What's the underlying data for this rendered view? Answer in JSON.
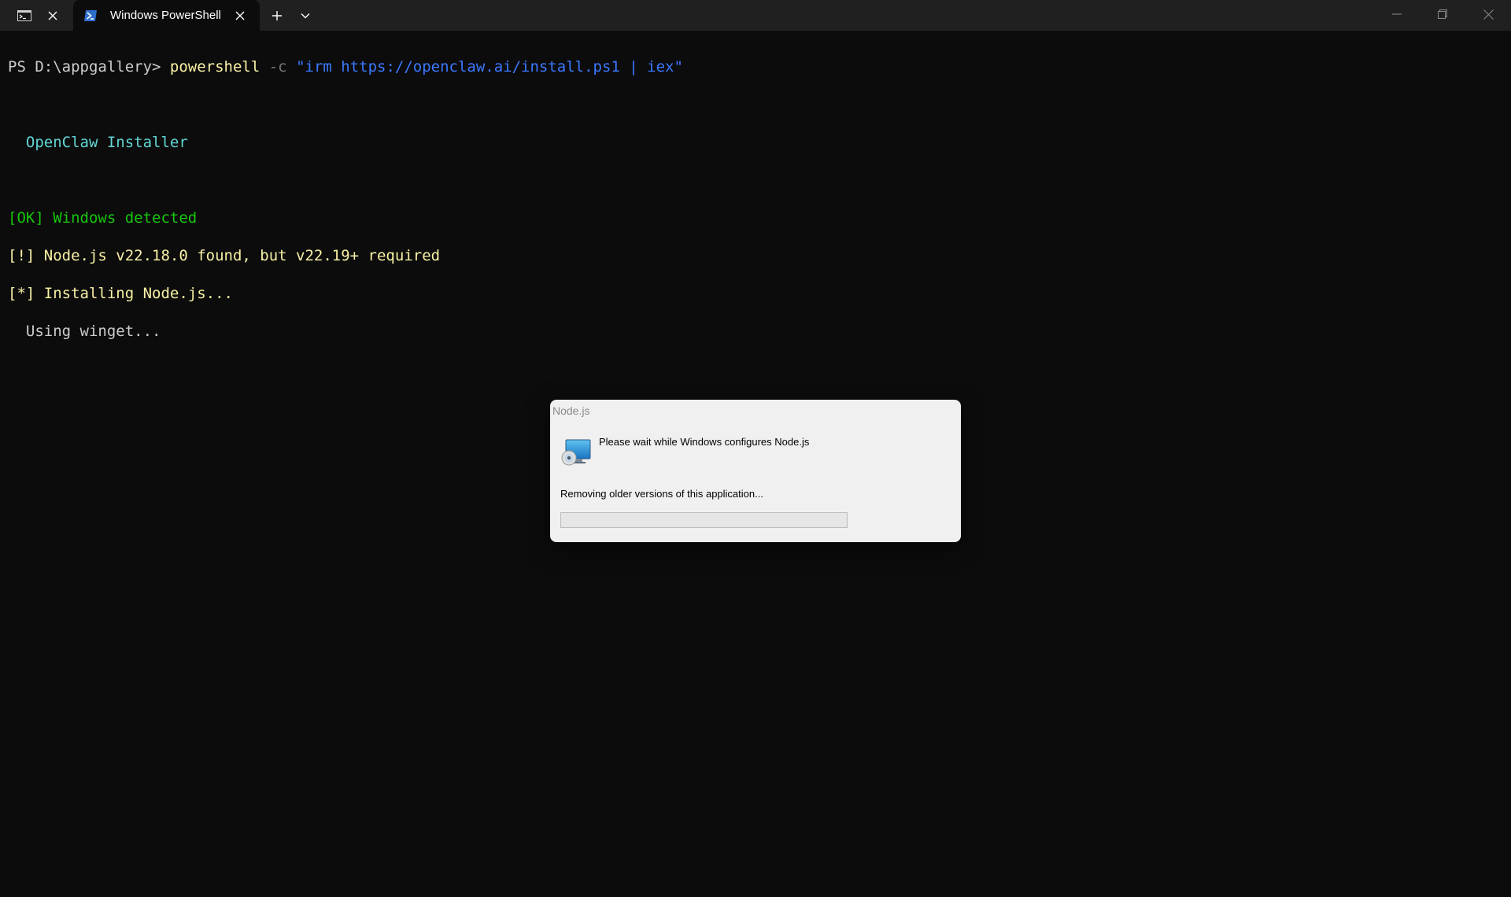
{
  "tabs": [
    {
      "title": "",
      "icon": "command-prompt-icon",
      "active": false
    },
    {
      "title": "Windows PowerShell",
      "icon": "powershell-icon",
      "active": true
    }
  ],
  "terminal": {
    "prompt": "PS D:\\appgallery> ",
    "command_name": "powershell",
    "command_flag": " -c ",
    "command_arg": "\"irm https://openclaw.ai/install.ps1 | iex\"",
    "installer_title": "  OpenClaw Installer",
    "line_ok": "[OK] Windows detected",
    "line_warn": "[!] Node.js v22.18.0 found, but v22.19+ required",
    "line_installing": "[*] Installing Node.js...",
    "line_winget": "  Using winget..."
  },
  "dialog": {
    "title": "Node.js",
    "message": "Please wait while Windows configures Node.js",
    "status": "Removing older versions of this application...",
    "icon": "installer-disc-icon",
    "progress": 0
  },
  "colors": {
    "terminal_bg": "#0c0c0c",
    "titlebar_bg": "#202020",
    "prompt_text": "#cccccc",
    "command": "#f9f1a5",
    "flag": "#767676",
    "string": "#3b78ff",
    "cyan": "#61d6d6",
    "green": "#16c60c",
    "yellow": "#f9f1a5"
  }
}
